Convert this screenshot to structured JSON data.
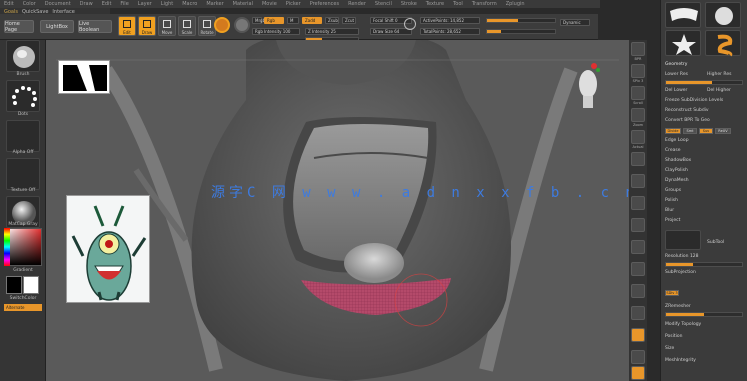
{
  "menubar": {
    "items": [
      "Edit",
      "Color",
      "Document",
      "Draw",
      "Edit",
      "File",
      "Layer",
      "Light",
      "Macro",
      "Marker",
      "Material",
      "Movie",
      "Picker",
      "Preferences",
      "Render",
      "Stencil",
      "Stroke",
      "Texture",
      "Tool",
      "Transform",
      "Zplugin",
      "Zscript",
      "Help"
    ]
  },
  "submenu": {
    "items": [
      "Home Page",
      "LightBox",
      "Live Boolean"
    ],
    "accent": [
      "Goals",
      "QuickSave",
      "Interface"
    ]
  },
  "shelf": {
    "edit_label": "Edit",
    "draw_label": "Draw",
    "move_label": "Move",
    "scale_label": "Scale",
    "rotate_label": "Rotate",
    "mrgb_label": "Mrgb",
    "rgb_label": "Rgb",
    "m_label": "M",
    "zadd_label": "Zadd",
    "zsub_label": "Zsub",
    "zcut_label": "Zcut",
    "focal_label": "Focal Shift 0",
    "draw_size_label": "Draw Size 64",
    "dynamic_label": "Dynamic",
    "rgb_intensity_label": "Rgb Intensity 100",
    "z_intensity_label": "Z Intensity 25",
    "active_points_label": "ActivePoints: 14,852",
    "total_points_label": "TotalPoints: 28,652",
    "home_page_label": "Home Page",
    "lightbox_label": "LightBox",
    "live_boolean_label": "Live Boolean"
  },
  "leftpanel": {
    "labels": [
      "Brush",
      "Dots",
      "Alpha Off",
      "Texture Off",
      "MatCap Gray",
      "Gradient",
      "SwitchColor",
      "Alternate"
    ]
  },
  "canvas": {
    "watermark": "源字C 网   w w w . a d n x x f b . c n"
  },
  "rightstrip": {
    "labels": [
      "BPR",
      "SPix 3",
      "Scroll",
      "Zoom",
      "Actual",
      "AAHalf",
      "Persp",
      "Floor",
      "Local",
      "Gxyz",
      "Frame",
      "Move",
      "Scale",
      "Rotate",
      "PolyF",
      "Transp",
      "Solo"
    ]
  },
  "rightpanel": {
    "tools": [
      "SimpleBrush",
      "PM3D_Sphere3D",
      "SphereBrush",
      "ZSphere"
    ],
    "rows": [
      "Geometry",
      "Lower Res",
      "Higher Res",
      "Del Lower",
      "Del Higher",
      "Freeze SubDivision Levels",
      "Reconstruct Subdiv",
      "Convert BPR To Geo",
      "Divide",
      "Edge Loop",
      "Crease",
      "ShadowBox",
      "ClayPolish",
      "DynaMesh",
      "Groups",
      "Polish",
      "Blur",
      "Project",
      "Resolution 128",
      "SubProjection",
      "ZRemesher",
      "Modify Topology",
      "Position",
      "Size",
      "MeshIntegrity"
    ],
    "subtool_label": "SubTool",
    "divide_label": "Divide",
    "smt_label": "Smt",
    "suv_label": "Suv",
    "reuv_label": "ReUV",
    "sdiv_label": "SDiv 3"
  },
  "colors": {
    "accent": "#e8962a",
    "panel": "#3b3b3b",
    "canvas": "#5c5c5c"
  }
}
